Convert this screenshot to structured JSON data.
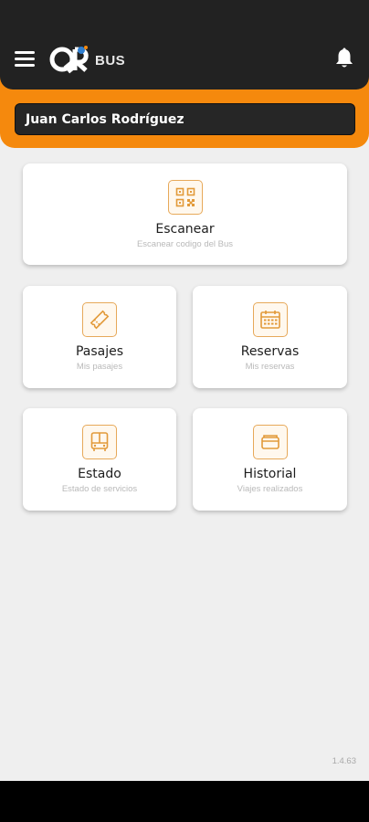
{
  "header": {
    "logo_text": "BUS",
    "brand_color": "#f5890d",
    "dark_color": "#222222"
  },
  "user": {
    "name": "Juan Carlos Rodríguez"
  },
  "cards": {
    "scan": {
      "title": "Escanear",
      "subtitle": "Escanear codigo del Bus",
      "icon": "qr-code-icon"
    },
    "pasajes": {
      "title": "Pasajes",
      "subtitle": "Mis pasajes",
      "icon": "ticket-icon"
    },
    "reservas": {
      "title": "Reservas",
      "subtitle": "Mis reservas",
      "icon": "calendar-icon"
    },
    "estado": {
      "title": "Estado",
      "subtitle": "Estado de servicios",
      "icon": "bus-icon"
    },
    "historial": {
      "title": "Historial",
      "subtitle": "Viajes realizados",
      "icon": "folder-icon"
    }
  },
  "footer": {
    "version": "1.4.63"
  }
}
